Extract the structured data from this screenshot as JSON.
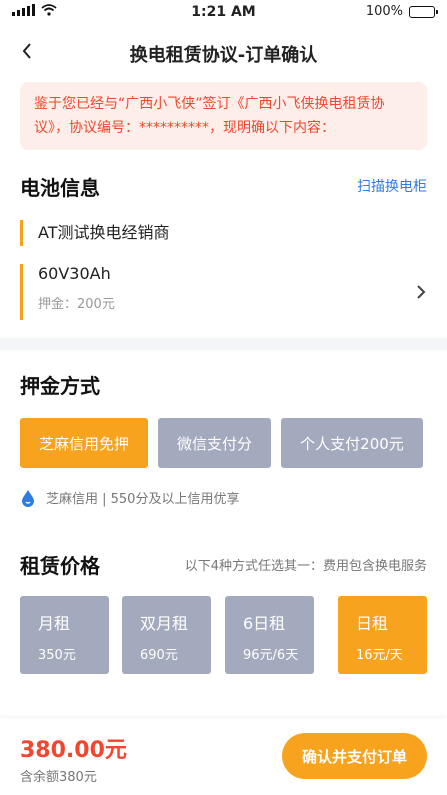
{
  "status": {
    "time": "1:21 AM",
    "battery": "100%"
  },
  "nav": {
    "title": "换电租赁协议-订单确认"
  },
  "notice": {
    "text": "鉴于您已经与“广西小飞侠”签订《广西小飞侠换电租赁协议》，协议编号：**********，现明确以下内容："
  },
  "battery_info": {
    "title": "电池信息",
    "scan_label": "扫描换电柜",
    "dealer": "AT测试换电经销商",
    "model": "60V30Ah",
    "deposit": "押金：200元"
  },
  "deposit_method": {
    "title": "押金方式",
    "options": [
      "芝麻信用免押",
      "微信支付分",
      "个人支付200元"
    ],
    "selected": 0,
    "credit_note": "芝麻信用 | 550分及以上信用优享"
  },
  "rental": {
    "title": "租赁价格",
    "note": "以下4种方式任选其一：费用包含换电服务",
    "plans": [
      {
        "name": "月租",
        "price": "350元"
      },
      {
        "name": "双月租",
        "price": "690元"
      },
      {
        "name": "6日租",
        "price": "96元/6天"
      },
      {
        "name": "日租",
        "price": "16元/天"
      }
    ],
    "selected": 3
  },
  "footer": {
    "total": "380.00元",
    "balance": "含余额380元",
    "pay_label": "确认并支付订单"
  },
  "colors": {
    "accent": "#f8a31d",
    "alert": "#f0472e",
    "link": "#2f7de1",
    "inactive": "#a3aabd"
  }
}
